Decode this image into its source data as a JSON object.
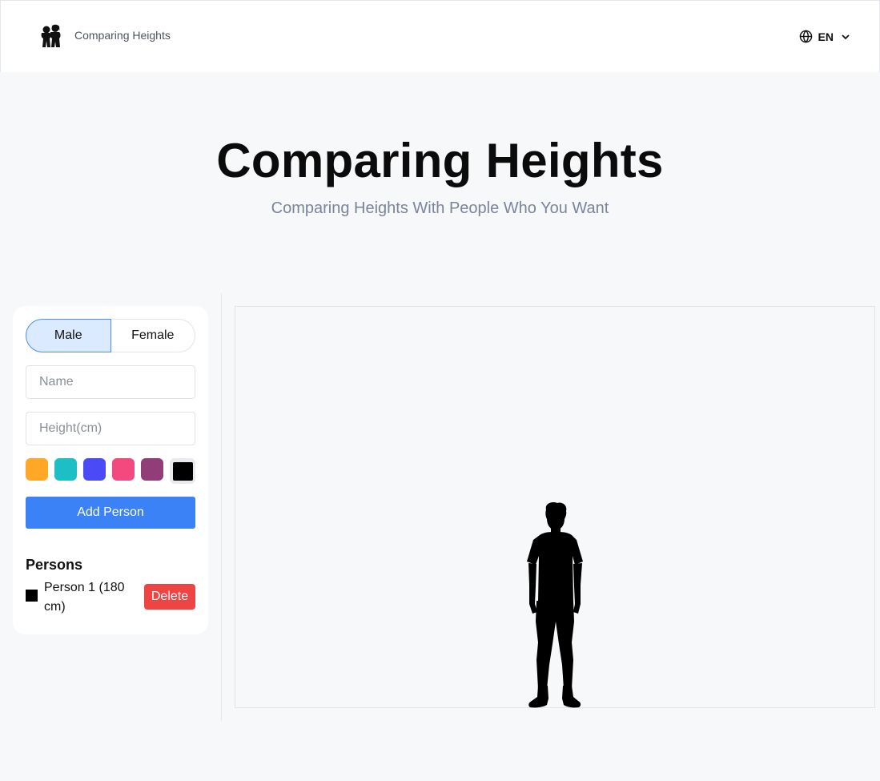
{
  "header": {
    "brand_name": "Comparing Heights",
    "logo_icon": "couple-silhouette-icon",
    "language": {
      "code": "EN",
      "icon": "globe-icon",
      "chevron": "chevron-down-icon"
    }
  },
  "hero": {
    "title": "Comparing Heights",
    "subtitle": "Comparing Heights With People Who You Want"
  },
  "form": {
    "gender_options": [
      "Male",
      "Female"
    ],
    "selected_gender": "Male",
    "name_placeholder": "Name",
    "name_value": "",
    "height_placeholder": "Height(cm)",
    "height_value": "",
    "colors": [
      "#ffa726",
      "#1cbfc3",
      "#4a4af6",
      "#f24a7e",
      "#913d78",
      "#000000"
    ],
    "selected_color": "#000000",
    "add_button_label": "Add Person"
  },
  "persons": {
    "title": "Persons",
    "items": [
      {
        "label": "Person 1 (180 cm)",
        "name": "Person 1",
        "height_cm": 180,
        "color": "#000000",
        "gender": "Male",
        "delete_label": "Delete"
      }
    ]
  },
  "theme": {
    "accent": "#3b82f6",
    "danger": "#ef4444",
    "page_background": "#f7f8fa",
    "active_gender_background": "#dbeafe"
  }
}
